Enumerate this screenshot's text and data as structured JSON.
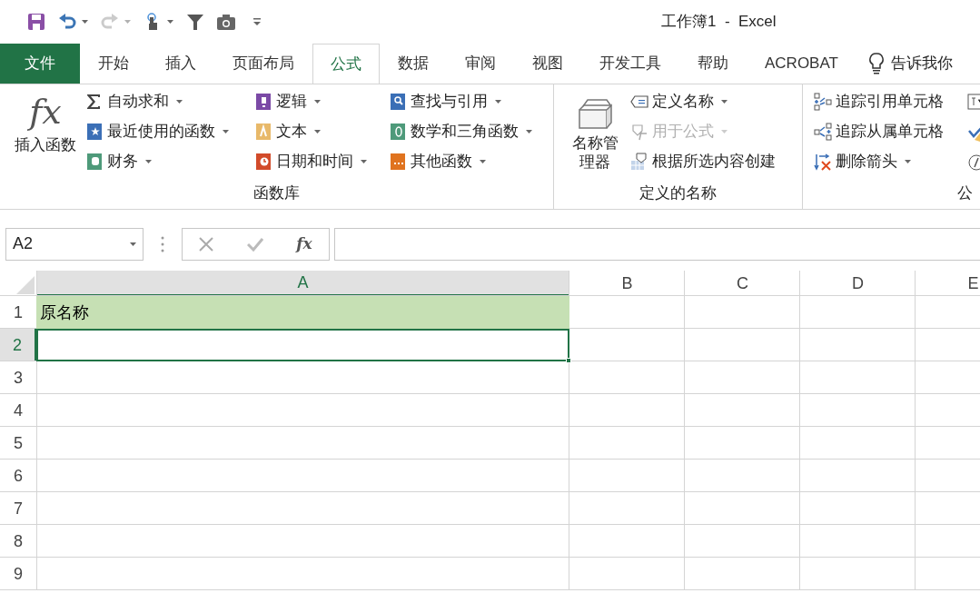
{
  "quick_access": [
    {
      "kind": "save",
      "disabled": false
    },
    {
      "kind": "undo",
      "disabled": false
    },
    {
      "kind": "redo",
      "disabled": true
    },
    {
      "kind": "touch",
      "disabled": false
    },
    {
      "kind": "filter",
      "disabled": false
    },
    {
      "kind": "camera",
      "disabled": false
    },
    {
      "kind": "customize",
      "disabled": false
    }
  ],
  "window": {
    "title": "工作簿1  -  Excel"
  },
  "file_tab": "文件",
  "tabs": [
    {
      "label": "开始",
      "selected": false
    },
    {
      "label": "插入",
      "selected": false
    },
    {
      "label": "页面布局",
      "selected": false
    },
    {
      "label": "公式",
      "selected": true
    },
    {
      "label": "数据",
      "selected": false
    },
    {
      "label": "审阅",
      "selected": false
    },
    {
      "label": "视图",
      "selected": false
    },
    {
      "label": "开发工具",
      "selected": false
    },
    {
      "label": "帮助",
      "selected": false
    },
    {
      "label": "ACROBAT",
      "selected": false
    }
  ],
  "tell_me": "告诉我你",
  "ribbon": {
    "groups": [
      {
        "label": "函数库",
        "large": [
          {
            "label": "插入函数",
            "symbol": "fx",
            "kind": "fx"
          }
        ],
        "columns": [
          [
            {
              "label": "自动求和",
              "kind": "sigma",
              "dropdown": true,
              "disabled": false
            },
            {
              "label": "最近使用的函数",
              "kind": "recent",
              "dropdown": true,
              "disabled": false
            },
            {
              "label": "财务",
              "kind": "financial",
              "dropdown": true,
              "disabled": false
            }
          ],
          [
            {
              "label": "逻辑",
              "kind": "logical",
              "dropdown": true,
              "disabled": false
            },
            {
              "label": "文本",
              "kind": "text",
              "dropdown": true,
              "disabled": false
            },
            {
              "label": "日期和时间",
              "kind": "datetime",
              "dropdown": true,
              "disabled": false
            }
          ],
          [
            {
              "label": "查找与引用",
              "kind": "lookup",
              "dropdown": true,
              "disabled": false
            },
            {
              "label": "数学和三角函数",
              "kind": "math",
              "dropdown": true,
              "disabled": false
            },
            {
              "label": "其他函数",
              "kind": "more",
              "dropdown": true,
              "disabled": false
            }
          ]
        ]
      },
      {
        "label": "定义的名称",
        "large": [
          {
            "label": "名称管理器",
            "kind": "name-manager"
          }
        ],
        "columns": [
          [
            {
              "label": "定义名称",
              "kind": "define",
              "dropdown": true,
              "disabled": false
            },
            {
              "label": "用于公式",
              "kind": "use",
              "dropdown": true,
              "disabled": true
            },
            {
              "label": "根据所选内容创建",
              "kind": "create",
              "dropdown": false,
              "disabled": false
            }
          ]
        ]
      },
      {
        "label": "公",
        "columns": [
          [
            {
              "label": "追踪引用单元格",
              "kind": "precedents",
              "dropdown": false,
              "disabled": false
            },
            {
              "label": "追踪从属单元格",
              "kind": "dependents",
              "dropdown": false,
              "disabled": false
            },
            {
              "label": "删除箭头",
              "kind": "remove",
              "dropdown": true,
              "disabled": false
            }
          ]
        ]
      }
    ]
  },
  "name_box": "A2",
  "formula_bar": {
    "fx": "fx"
  },
  "columns": [
    {
      "label": "A",
      "selected": true
    },
    {
      "label": "B",
      "selected": false
    },
    {
      "label": "C",
      "selected": false
    },
    {
      "label": "D",
      "selected": false
    },
    {
      "label": "E",
      "selected": false
    }
  ],
  "rows": [
    {
      "label": "1",
      "selected": false,
      "cells": [
        {
          "text": "原名称",
          "highlighted": true,
          "selected": false
        }
      ]
    },
    {
      "label": "2",
      "selected": true,
      "cells": [
        {
          "highlighted": false,
          "selected": true
        }
      ]
    },
    {
      "label": "3",
      "selected": false
    },
    {
      "label": "4",
      "selected": false
    },
    {
      "label": "5",
      "selected": false
    },
    {
      "label": "6",
      "selected": false
    },
    {
      "label": "7",
      "selected": false
    },
    {
      "label": "8",
      "selected": false
    },
    {
      "label": "9",
      "selected": false
    }
  ]
}
